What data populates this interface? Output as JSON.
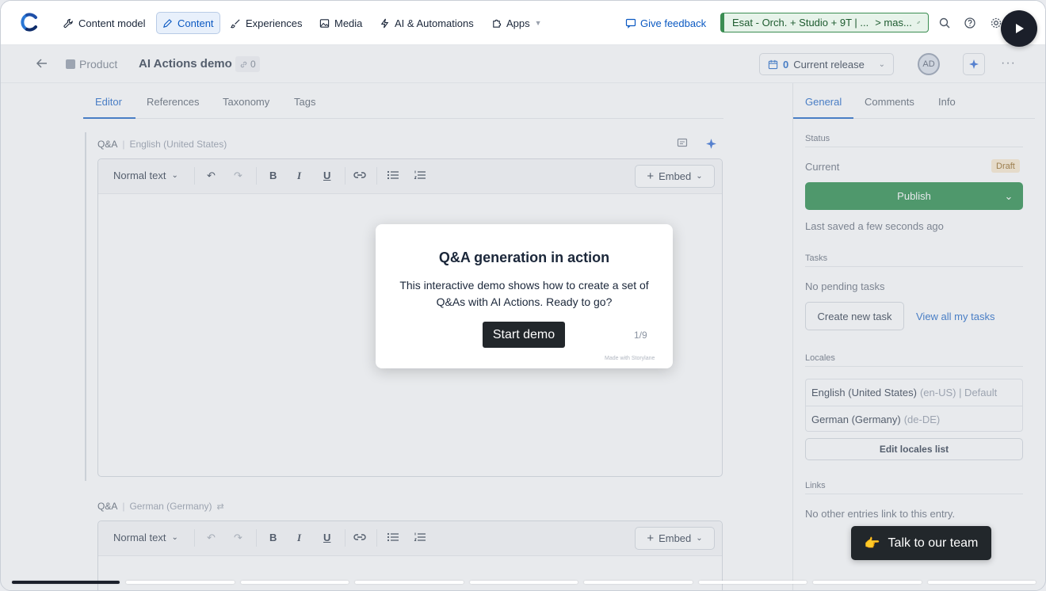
{
  "nav": {
    "items": [
      {
        "label": "Content model",
        "icon": "wrench-icon"
      },
      {
        "label": "Content",
        "icon": "pen-icon"
      },
      {
        "label": "Experiences",
        "icon": "brush-icon"
      },
      {
        "label": "Media",
        "icon": "image-icon"
      },
      {
        "label": "AI & Automations",
        "icon": "bolt-icon"
      },
      {
        "label": "Apps",
        "icon": "puzzle-icon"
      }
    ],
    "feedback": "Give feedback",
    "environment": "Esat - Orch. + Studio + 9T | ...",
    "environment_branch": "> mas...",
    "env_color": "#3b8d52"
  },
  "entry": {
    "content_type": "Product",
    "title": "AI Actions demo",
    "ref_count": "0",
    "release_count": "0",
    "release_label": "Current release",
    "avatar_initials": "AD"
  },
  "editor_tabs": [
    "Editor",
    "References",
    "Taxonomy",
    "Tags"
  ],
  "fields": [
    {
      "name": "Q&A",
      "locale": "English (United States)"
    },
    {
      "name": "Q&A",
      "locale": "German (Germany)"
    }
  ],
  "toolbar": {
    "format": "Normal text",
    "embed": "Embed"
  },
  "sidebar": {
    "tabs": [
      "General",
      "Comments",
      "Info"
    ],
    "status_heading": "Status",
    "current_label": "Current",
    "draft_badge": "Draft",
    "publish_label": "Publish",
    "last_saved": "Last saved a few seconds ago",
    "tasks_heading": "Tasks",
    "no_tasks": "No pending tasks",
    "create_task": "Create new task",
    "view_tasks": "View all my tasks",
    "locales_heading": "Locales",
    "locales": [
      {
        "name": "English (United States)",
        "detail": "(en-US) | Default"
      },
      {
        "name": "German (Germany)",
        "detail": "(de-DE)"
      }
    ],
    "edit_locales": "Edit locales list",
    "links_heading": "Links",
    "no_links": "No other entries link to this entry."
  },
  "demo": {
    "title": "Q&A generation in action",
    "body": "This interactive demo shows how to create a set of Q&As with AI Actions. Ready to go?",
    "start": "Start demo",
    "step": "1/9",
    "made_with": "Made with Storylane",
    "talk_button": "Talk to our team",
    "talk_emoji": "👉",
    "progress_total": 9,
    "progress_current": 1
  },
  "colors": {
    "accent": "#0b59c2",
    "publish": "#14823a",
    "draft_bg": "#fbe9c9"
  }
}
